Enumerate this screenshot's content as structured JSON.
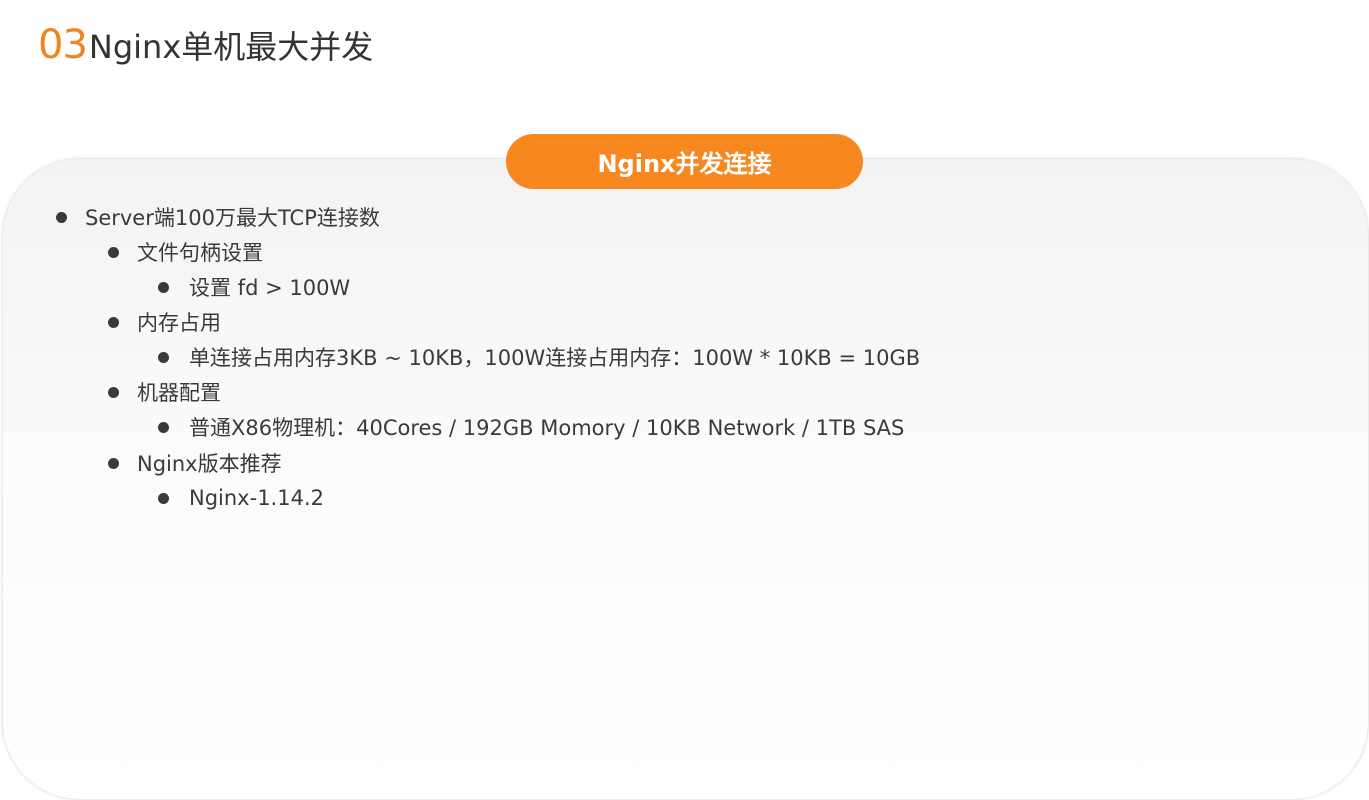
{
  "header": {
    "number": "03",
    "title": "Nginx单机最大并发"
  },
  "section": {
    "label": "Nginx并发连接"
  },
  "outline": [
    {
      "level": 1,
      "text": "Server端100万最大TCP连接数"
    },
    {
      "level": 2,
      "text": "文件句柄设置"
    },
    {
      "level": 3,
      "text": "设置 fd > 100W"
    },
    {
      "level": 2,
      "text": "内存占用"
    },
    {
      "level": 3,
      "text": "单连接占用内存3KB ~ 10KB，100W连接占用内存：100W * 10KB = 10GB"
    },
    {
      "level": 2,
      "text": "机器配置"
    },
    {
      "level": 3,
      "text": "普通X86物理机：40Cores / 192GB Momory / 10KB Network / 1TB SAS"
    },
    {
      "level": 2,
      "text": "Nginx版本推荐"
    },
    {
      "level": 3,
      "text": "Nginx-1.14.2"
    }
  ],
  "colors": {
    "accent": "#f7871f",
    "number": "#f0841f",
    "text": "#3a3a3a"
  }
}
